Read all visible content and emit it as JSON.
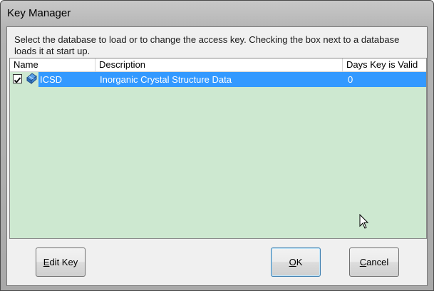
{
  "window": {
    "title": "Key Manager"
  },
  "instruction": "Select the database to load or to change the access key.  Checking the box next to a database loads it at start up.",
  "list": {
    "columns": [
      "Name",
      "Description",
      "Days Key is Valid"
    ],
    "rows": [
      {
        "checked": true,
        "icon": "database-icon",
        "name": "ICSD",
        "description": "Inorganic Crystal Structure Data",
        "days": "0"
      }
    ],
    "background_color": "#cde8d0",
    "selection_color": "#3399ff"
  },
  "buttons": {
    "edit_key": {
      "mnemonic": "E",
      "rest": "dit Key"
    },
    "ok": {
      "mnemonic": "O",
      "rest": "K"
    },
    "cancel": {
      "mnemonic": "C",
      "rest": "ancel"
    }
  }
}
